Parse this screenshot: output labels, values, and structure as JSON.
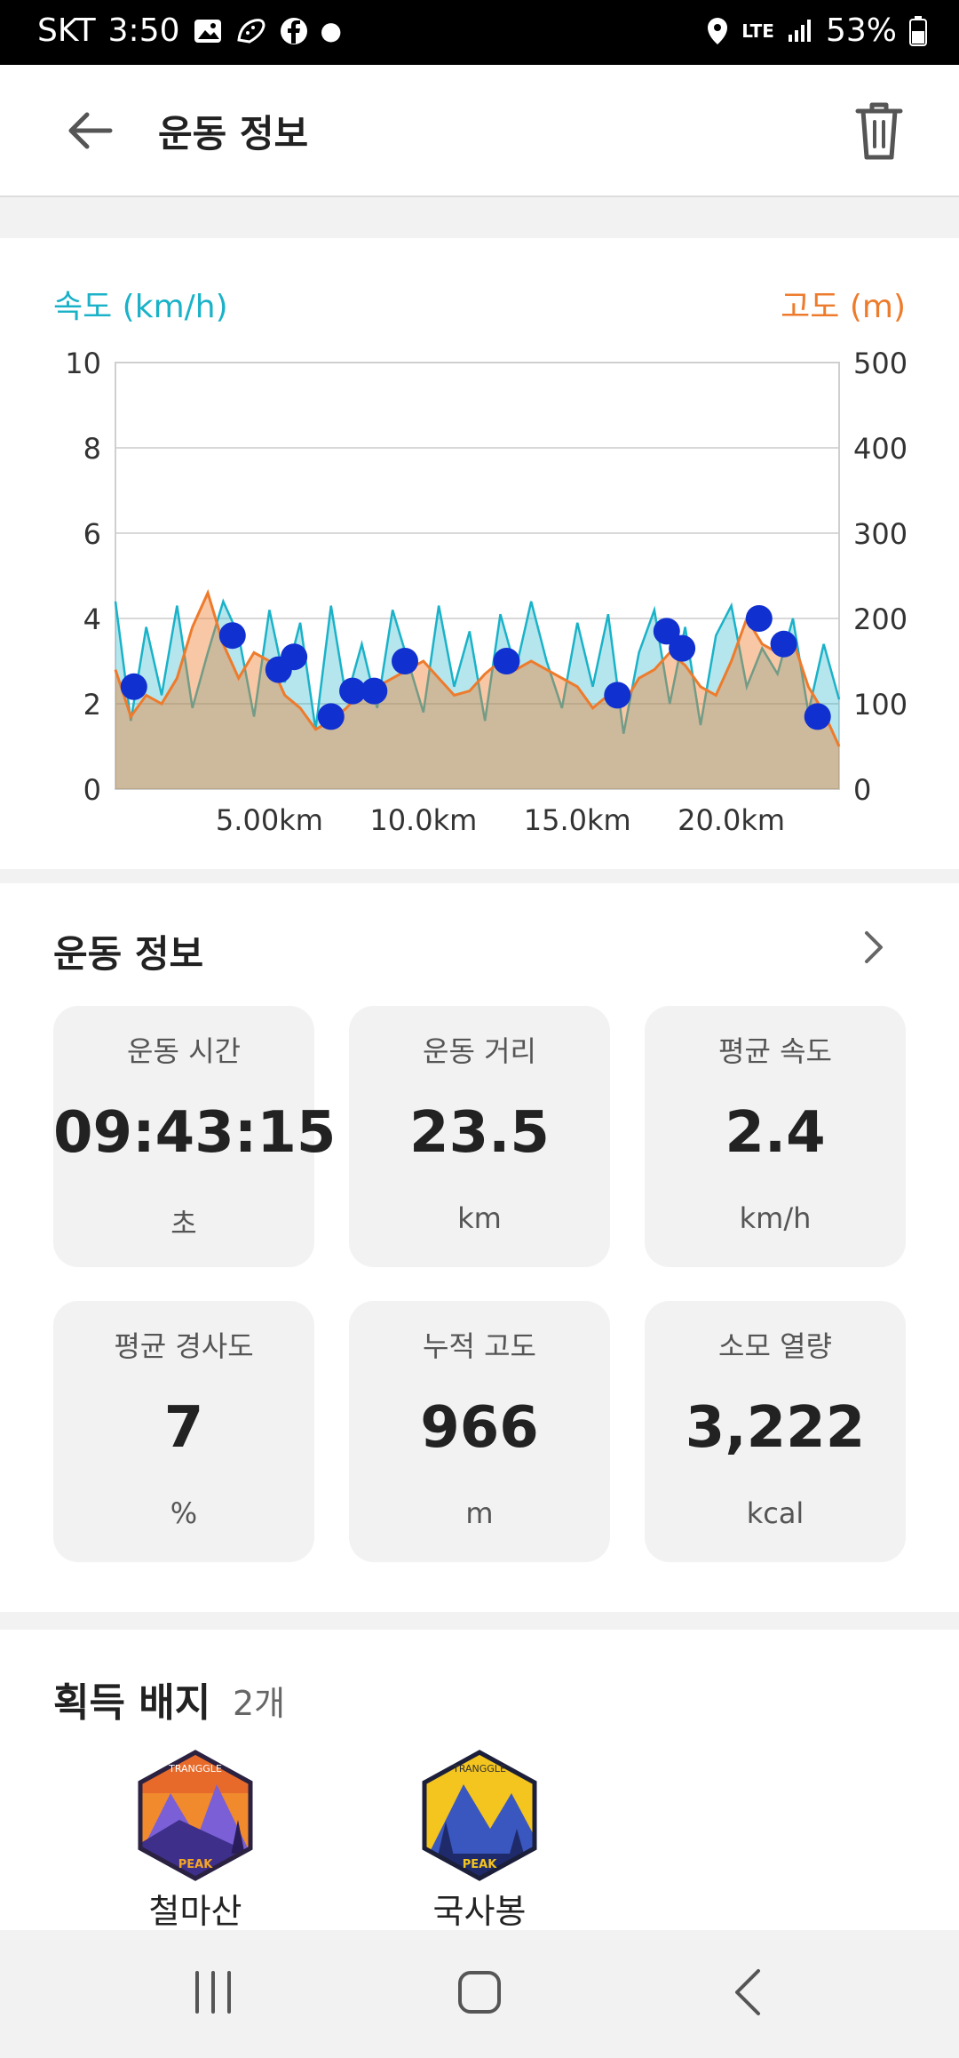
{
  "status": {
    "carrier": "SKT",
    "time": "3:50",
    "network": "LTE",
    "battery": "53%"
  },
  "header": {
    "title": "운동 정보"
  },
  "chart_data": {
    "type": "line",
    "left_axis_label": "속도 (km/h)",
    "right_axis_label": "고도 (m)",
    "left_ylim": [
      0,
      10
    ],
    "right_ylim": [
      0,
      500
    ],
    "left_ticks": [
      "10",
      "8",
      "6",
      "4",
      "2",
      "0"
    ],
    "right_ticks": [
      "500",
      "400",
      "300",
      "200",
      "100",
      "0"
    ],
    "xlim": [
      0,
      23.5
    ],
    "x_tick_labels": [
      "5.00km",
      "10.0km",
      "15.0km",
      "20.0km"
    ],
    "x_ticks": [
      5,
      10,
      15,
      20
    ],
    "grid": true,
    "series": [
      {
        "color": "#1ab2c8",
        "axis": "left",
        "x": [
          0,
          0.5,
          1,
          1.5,
          2,
          2.5,
          3,
          3.5,
          4,
          4.5,
          5,
          5.5,
          6,
          6.5,
          7,
          7.5,
          8,
          8.5,
          9,
          9.5,
          10,
          10.5,
          11,
          11.5,
          12,
          12.5,
          13,
          13.5,
          14,
          14.5,
          15,
          15.5,
          16,
          16.5,
          17,
          17.5,
          18,
          18.5,
          19,
          19.5,
          20,
          20.5,
          21,
          21.5,
          22,
          22.5,
          23,
          23.5
        ],
        "values": [
          4.4,
          1.6,
          3.8,
          2.2,
          4.3,
          1.9,
          3.2,
          4.4,
          3.6,
          1.7,
          4.2,
          2.5,
          3.9,
          1.4,
          4.3,
          2.1,
          3.4,
          1.9,
          4.2,
          3.0,
          1.8,
          4.3,
          2.4,
          3.7,
          1.6,
          4.1,
          2.8,
          4.4,
          3.0,
          1.9,
          3.9,
          2.4,
          4.1,
          1.3,
          3.2,
          4.2,
          2.0,
          3.8,
          1.5,
          3.6,
          4.3,
          2.4,
          3.3,
          2.7,
          4.0,
          1.8,
          3.4,
          2.1
        ]
      },
      {
        "color": "#ee7b2c",
        "axis": "right",
        "x": [
          0,
          0.5,
          1,
          1.5,
          2,
          2.5,
          3,
          3.5,
          4,
          4.5,
          5,
          5.5,
          6,
          6.5,
          7,
          7.5,
          8,
          8.5,
          9,
          9.5,
          10,
          10.5,
          11,
          11.5,
          12,
          12.5,
          13,
          13.5,
          14,
          14.5,
          15,
          15.5,
          16,
          16.5,
          17,
          17.5,
          18,
          18.5,
          19,
          19.5,
          20,
          20.5,
          21,
          21.5,
          22,
          22.5,
          23,
          23.5
        ],
        "values": [
          140,
          85,
          110,
          100,
          130,
          190,
          230,
          170,
          130,
          160,
          150,
          110,
          95,
          70,
          80,
          95,
          115,
          120,
          130,
          140,
          150,
          130,
          110,
          115,
          135,
          150,
          140,
          150,
          140,
          130,
          120,
          95,
          110,
          100,
          130,
          140,
          160,
          145,
          120,
          110,
          150,
          200,
          170,
          160,
          175,
          120,
          90,
          50
        ]
      }
    ],
    "markers": {
      "color": "#1030d0",
      "axis": "left",
      "x": [
        0.6,
        3.8,
        5.3,
        5.8,
        7.0,
        7.7,
        8.4,
        9.4,
        12.7,
        16.3,
        17.9,
        18.4,
        20.9,
        21.7,
        22.8
      ],
      "values": [
        2.4,
        3.6,
        2.8,
        3.1,
        1.7,
        2.3,
        2.3,
        3.0,
        3.0,
        2.2,
        3.7,
        3.3,
        4.0,
        3.4,
        1.7
      ]
    }
  },
  "summary": {
    "title": "운동 정보",
    "stats": [
      {
        "label": "운동 시간",
        "value": "09:43:15",
        "unit": "초"
      },
      {
        "label": "운동 거리",
        "value": "23.5",
        "unit": "km"
      },
      {
        "label": "평균 속도",
        "value": "2.4",
        "unit": "km/h"
      },
      {
        "label": "평균 경사도",
        "value": "7",
        "unit": "%"
      },
      {
        "label": "누적 고도",
        "value": "966",
        "unit": "m"
      },
      {
        "label": "소모 열량",
        "value": "3,222",
        "unit": "kcal"
      }
    ]
  },
  "badges": {
    "title": "획득 배지",
    "count": "2개",
    "items": [
      {
        "name": "철마산",
        "logo_text_top": "TRANGGLE",
        "logo_text_bottom": "PEAK",
        "colors": [
          "#f08a2c",
          "#7a5fd6",
          "#3e2f8a"
        ]
      },
      {
        "name": "국사봉",
        "logo_text_top": "TRANGGLE",
        "logo_text_bottom": "PEAK",
        "colors": [
          "#f4c51e",
          "#3a57c0",
          "#1e2a6a"
        ]
      }
    ]
  },
  "icons": {
    "back": "arrow-left-icon",
    "delete": "trash-icon",
    "more": "chevron-right-icon"
  }
}
